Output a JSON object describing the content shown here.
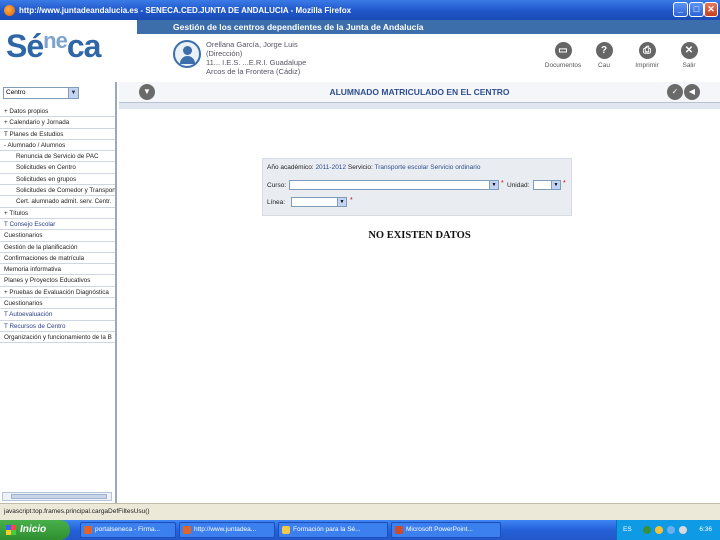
{
  "window": {
    "title": "http://www.juntadeandalucia.es - SENECA.CED.JUNTA DE ANDALUCIA - Mozilla Firefox"
  },
  "header": {
    "band_title": "Gestión de los centros dependientes de la Junta de Andalucía",
    "logo": {
      "a": "Sé",
      "b": "ne",
      "c": "ca"
    },
    "user": {
      "name": "Orellana García, Jorge Luis",
      "role": "(Dirección)",
      "center": "11... I.E.S. ...E.R.I. Guadalupe",
      "city": "Arcos de la Frontera (Cádiz)"
    },
    "tools": [
      {
        "label": "Documentos",
        "icon": "documents-icon"
      },
      {
        "label": "Cau",
        "icon": "help-icon"
      },
      {
        "label": "Imprimir",
        "icon": "print-icon"
      },
      {
        "label": "Salir",
        "icon": "exit-icon"
      }
    ]
  },
  "sidebar": {
    "select_value": "Centro",
    "items": [
      {
        "label": "+ Datos propios",
        "sub": false
      },
      {
        "label": "+ Calendario y Jornada",
        "sub": false
      },
      {
        "label": "T  Planes de Estudios",
        "sub": false
      },
      {
        "label": "- Alumnado / Alumnos",
        "sub": false
      },
      {
        "label": "Renuncia de Servicio de PAC",
        "sub": true
      },
      {
        "label": "Solicitudes en Centro",
        "sub": true
      },
      {
        "label": "Solicitudes en grupos",
        "sub": true
      },
      {
        "label": "Solicitudes de Comedor y Transporte",
        "sub": true
      },
      {
        "label": "Cert. alumnado admit. serv. Centr.",
        "sub": true
      },
      {
        "label": "+ Títulos",
        "sub": false
      },
      {
        "label": "T  Consejo Escolar",
        "sub": false
      },
      {
        "label": "Cuestionarios",
        "sub": false
      },
      {
        "label": "Gestión de la planificación",
        "sub": false
      },
      {
        "label": "Confirmaciones de matrícula",
        "sub": false
      },
      {
        "label": "Memoria informativa",
        "sub": false
      },
      {
        "label": "Planes y Proyectos Educativos",
        "sub": false
      },
      {
        "label": "+ Pruebas de Evaluación Diagnóstica",
        "sub": false
      },
      {
        "label": "Cuestionarios",
        "sub": false
      },
      {
        "label": "T  Autoevaluación",
        "sub": false
      },
      {
        "label": "T  Recursos de Centro",
        "sub": false
      },
      {
        "label": "Organización y funcionamiento de la B",
        "sub": false
      }
    ]
  },
  "main": {
    "title": "ALUMNADO MATRICULADO EN EL CENTRO",
    "filter": {
      "year_label": "Año académico:",
      "year_value": "2011-2012",
      "service_label": "Servicio:",
      "service_option_1": "Transporte escolar",
      "service_option_2": "Servicio ordinario",
      "course_label": "Curso:",
      "unit_label": "Unidad:",
      "route_label": "Línea:",
      "required_mark": "*"
    },
    "empty_message": "NO EXISTEN DATOS"
  },
  "statusbar": {
    "text": "javascript:top.frames.principal.cargaDefFiltesUsu()"
  },
  "taskbar": {
    "start_label": "Inicio",
    "tasks": [
      {
        "label": "portalseneca - Firma...",
        "color": "#e0642a"
      },
      {
        "label": "http://www.juntadea...",
        "color": "#e0642a"
      },
      {
        "label": "Formación para la Sé...",
        "color": "#f2c94c"
      },
      {
        "label": "Microsoft PowerPoint...",
        "color": "#d04b2a"
      }
    ],
    "lang": "ES",
    "time": "6:36"
  }
}
